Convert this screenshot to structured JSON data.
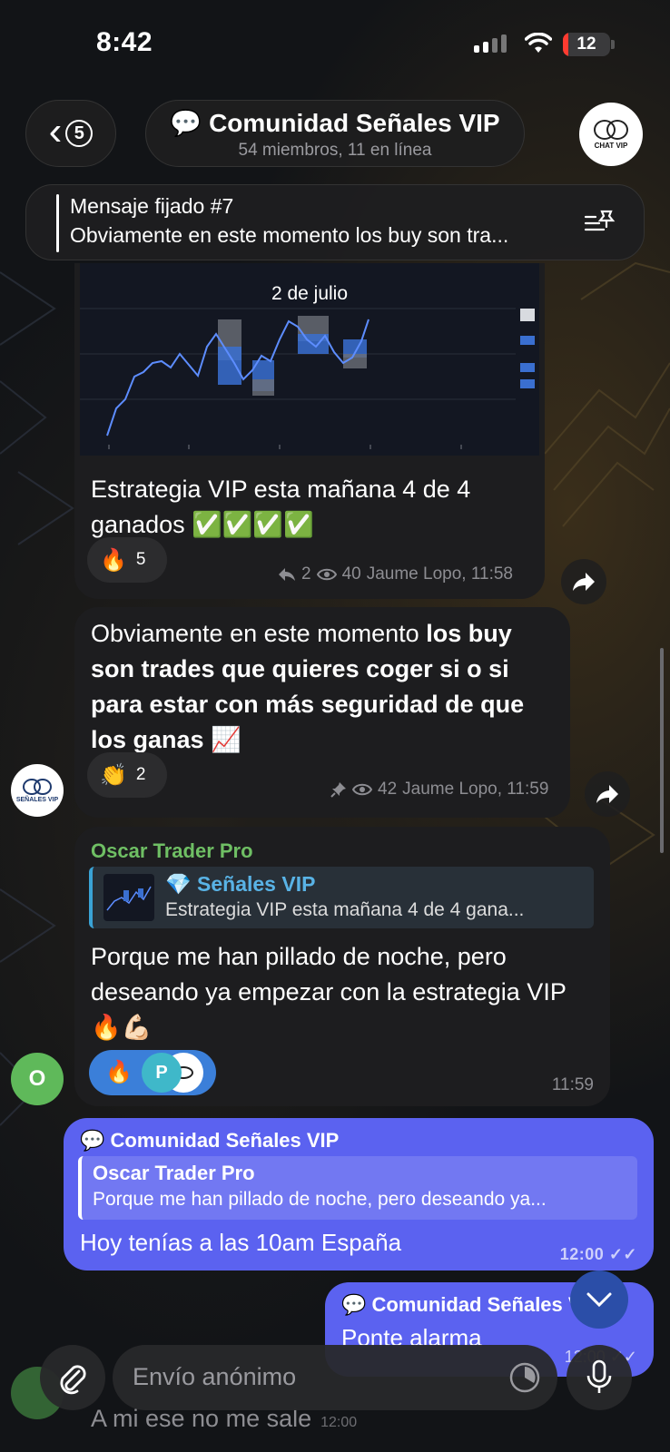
{
  "status": {
    "time": "8:42",
    "battery": "12",
    "battery_level": 0.12
  },
  "header": {
    "back_count": "5",
    "chat_emoji": "💬",
    "title": "Comunidad Señales VIP",
    "subtitle": "54 miembros, 11 en línea",
    "avatar_label": "CHAT VIP"
  },
  "pinned": {
    "title": "Mensaje fijado #7",
    "text": "Obviamente en este momento los buy son tra..."
  },
  "messages": {
    "m1": {
      "image_caption": "2 de julio",
      "text": "Estrategia VIP esta mañana 4 de 4 ganados ✅✅✅✅",
      "reaction_emoji": "🔥",
      "reaction_count": "5",
      "replies": "2",
      "views": "40",
      "author_time": "Jaume Lopo, 11:58"
    },
    "m2": {
      "text_plain": "Obviamente en este momento ",
      "text_bold": "los buy son trades que quieres coger si o si para estar con más seguridad de que los ganas",
      "text_emoji": "📈",
      "reaction_emoji": "👏",
      "reaction_count": "2",
      "views": "42",
      "author_time": "Jaume Lopo, 11:59",
      "avatar_label": "SEÑALES VIP"
    },
    "m3": {
      "sender": "Oscar Trader Pro",
      "quote_name": "💎 Señales VIP",
      "quote_text": "Estrategia VIP esta mañana 4 de 4 gana...",
      "text": "Porque me han pillado de noche, pero deseando ya empezar con la estrategia VIP🔥💪🏻",
      "reaction_emoji": "🔥",
      "reactor_initial": "P",
      "time": "11:59",
      "avatar_initial": "O"
    },
    "m4": {
      "sender": "💬 Comunidad Señales VIP",
      "quote_name": "Oscar Trader Pro",
      "quote_text": "Porque me han pillado de noche, pero deseando ya...",
      "text": "Hoy tenías a las 10am España",
      "time": "12:00"
    },
    "m5": {
      "sender": "💬 Comunidad Señales VIP",
      "text": "Ponte alarma",
      "time": "12:00"
    },
    "m6_partial": {
      "text": "A mi ese no me sale",
      "time": "12:00"
    }
  },
  "input": {
    "placeholder": "Envío anónimo"
  },
  "colors": {
    "own_bubble": "#5b62f0",
    "other_bubble": "#1d1d1f",
    "sender_green": "#6fbf64",
    "quote_blue": "#59b3e6"
  }
}
